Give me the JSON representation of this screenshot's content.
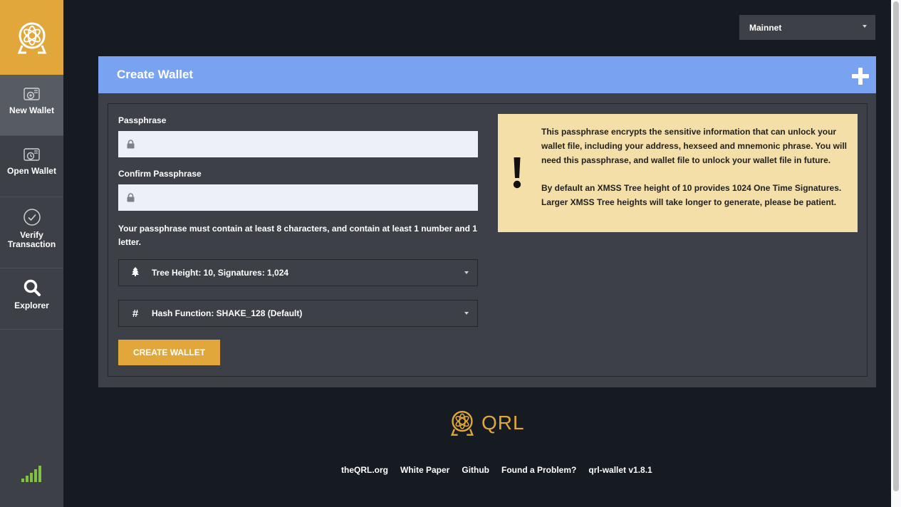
{
  "sidebar": {
    "items": [
      {
        "label": "New Wallet",
        "icon": "new-wallet-icon"
      },
      {
        "label": "Open Wallet",
        "icon": "open-wallet-icon"
      },
      {
        "label": "Verify Transaction",
        "icon": "check-circle-icon"
      },
      {
        "label": "Explorer",
        "icon": "search-icon"
      }
    ],
    "active": "New Wallet"
  },
  "network": {
    "selected": "Mainnet"
  },
  "card": {
    "title": "Create Wallet",
    "passphrase_label": "Passphrase",
    "confirm_label": "Confirm Passphrase",
    "passphrase_value": "",
    "confirm_value": "",
    "hint": "Your passphrase must contain at least 8 characters, and contain at least 1 number and 1 letter.",
    "tree_height": "Tree Height: 10, Signatures: 1,024",
    "hash_function": "Hash Function: SHAKE_128 (Default)",
    "create_button": "CREATE WALLET",
    "info_p1": "This passphrase encrypts the sensitive information that can unlock your wallet file, including your address, hexseed and mnemonic phrase. You will need this passphrase, and wallet file to unlock your wallet file in future.",
    "info_p2": "By default an XMSS Tree height of 10 provides 1024 One Time Signatures. Larger XMSS Tree heights will take longer to generate, please be patient."
  },
  "footer": {
    "brand": "QRL",
    "links": [
      "theQRL.org",
      "White Paper",
      "Github",
      "Found a Problem?",
      "qrl-wallet v1.8.1"
    ]
  },
  "colors": {
    "accent": "#e2a73a",
    "header_blue": "#79a3f1",
    "background": "#161b22",
    "panel": "#3d4147",
    "info_bg": "#f4dfa9",
    "signal": "#7fc241"
  }
}
